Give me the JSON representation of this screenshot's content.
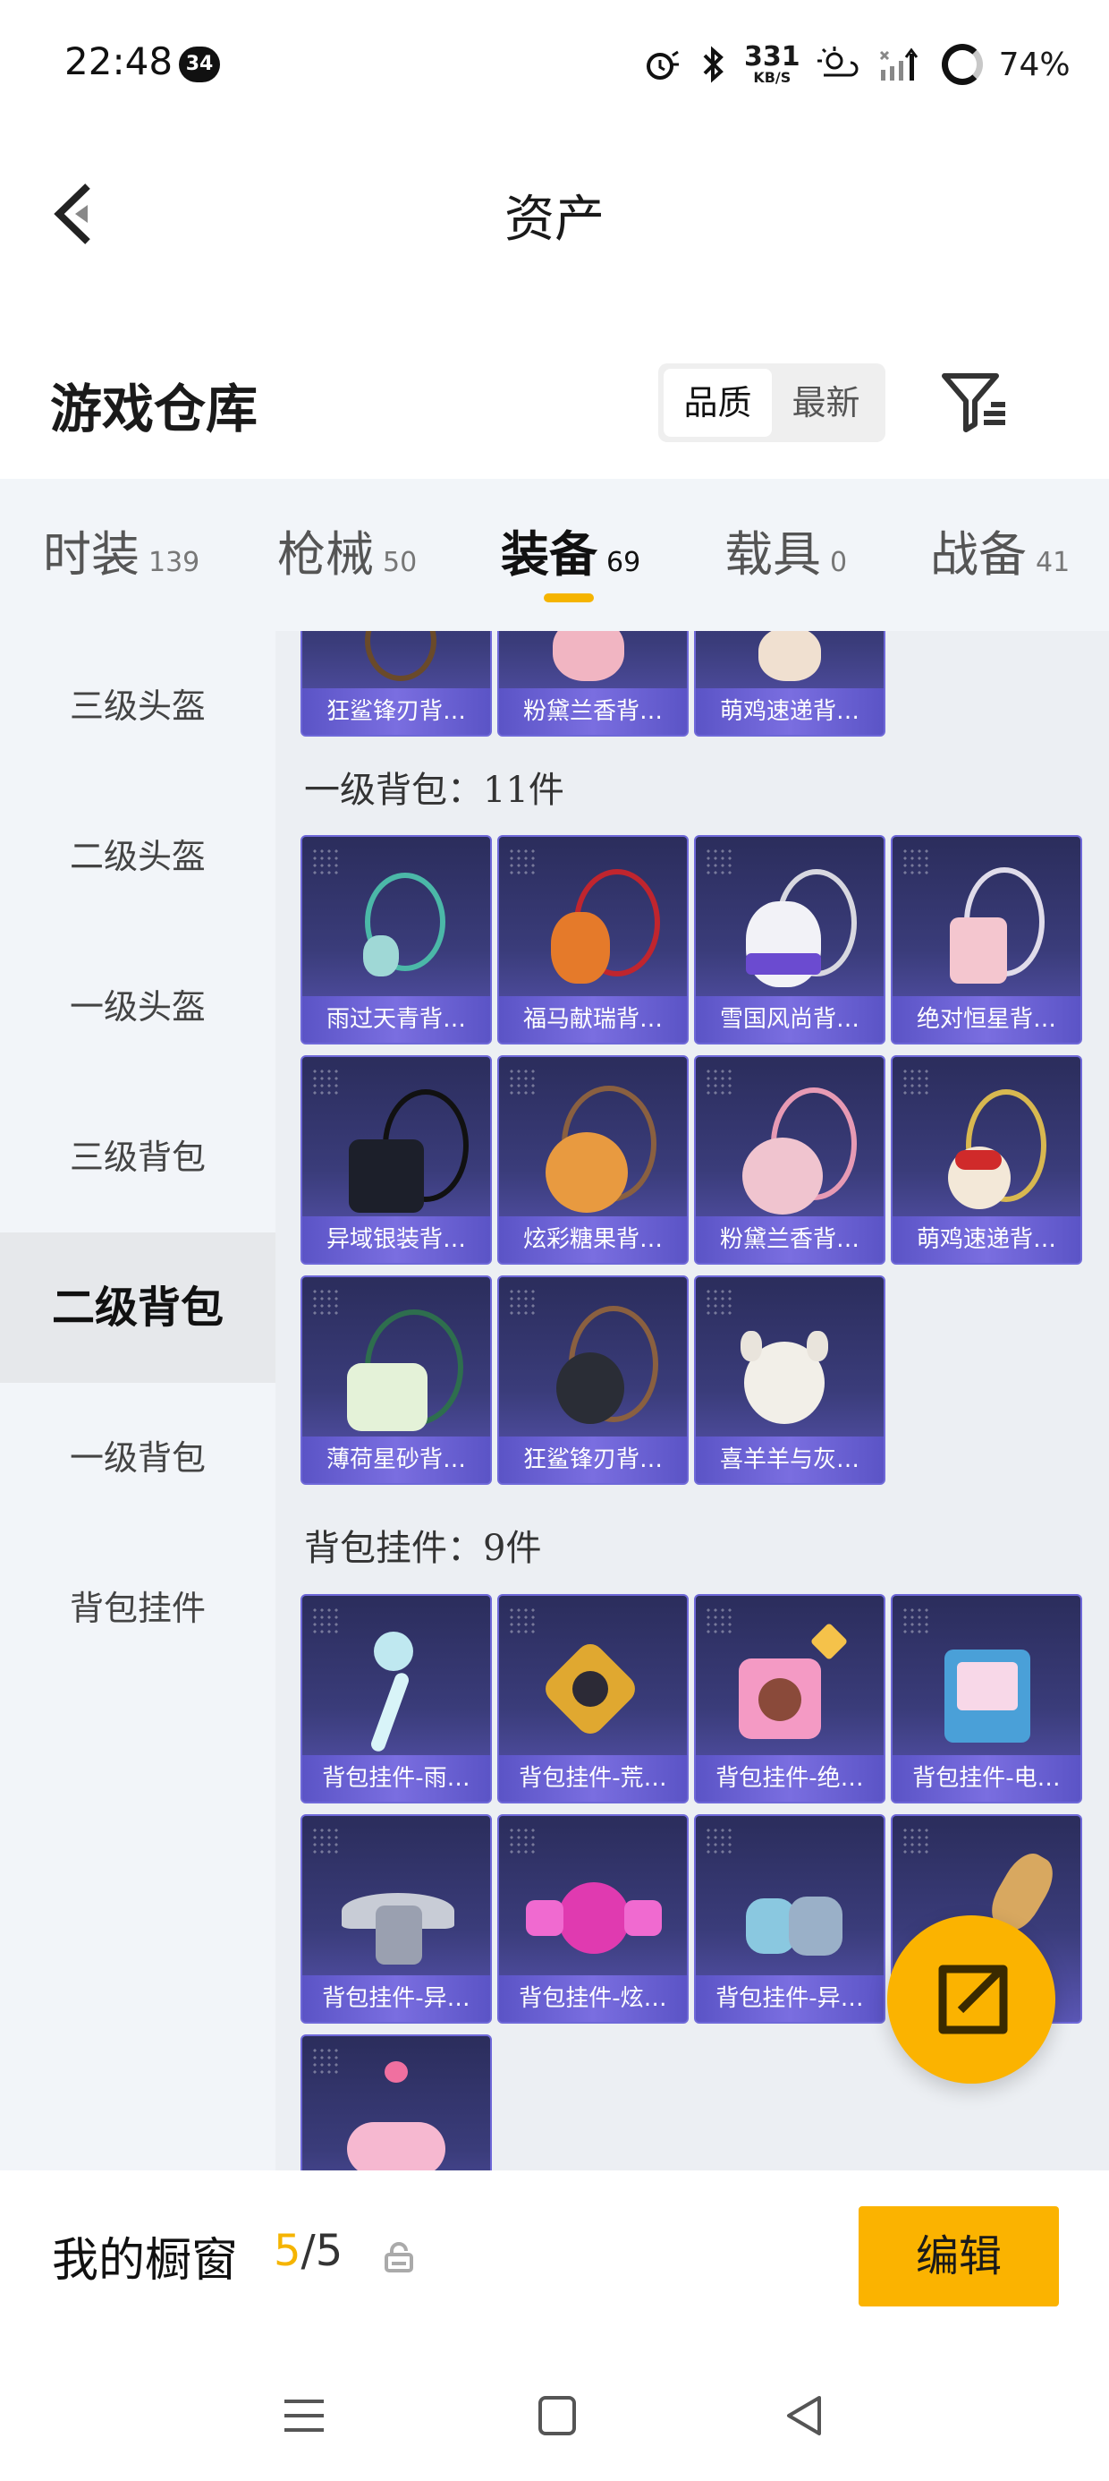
{
  "status": {
    "time": "22:48",
    "badge": "34",
    "speed_value": "331",
    "speed_unit": "KB/S",
    "battery": "74%",
    "icons": [
      "alarm-icon",
      "bluetooth-icon",
      "network-speed",
      "weather-icon",
      "signal-icon",
      "battery-icon"
    ]
  },
  "nav": {
    "title": "资产",
    "back_icon": "chevron-left-icon"
  },
  "warehouse": {
    "title": "游戏仓库",
    "sort_options": [
      "品质",
      "最新"
    ],
    "active_sort": "品质",
    "filter_icon": "filter-icon"
  },
  "tabs": [
    {
      "label": "时装",
      "count": "139"
    },
    {
      "label": "枪械",
      "count": "50"
    },
    {
      "label": "装备",
      "count": "69"
    },
    {
      "label": "载具",
      "count": "0"
    },
    {
      "label": "战备",
      "count": "41"
    }
  ],
  "active_tab": "装备",
  "accent_color": "#f5b400",
  "sidebar": {
    "items": [
      {
        "label": "三级头盔"
      },
      {
        "label": "二级头盔"
      },
      {
        "label": "一级头盔"
      },
      {
        "label": "三级背包"
      },
      {
        "label": "二级背包"
      },
      {
        "label": "一级背包"
      },
      {
        "label": "背包挂件"
      }
    ],
    "active": "二级背包"
  },
  "sections": {
    "top_partial": {
      "items": [
        "狂鲨锋刃背…",
        "粉黛兰香背…",
        "萌鸡速递背…"
      ]
    },
    "level1_backpacks": {
      "title": "一级背包：11件",
      "items": [
        "雨过天青背…",
        "福马献瑞背…",
        "雪国风尚背…",
        "绝对恒星背…",
        "异域银装背…",
        "炫彩糖果背…",
        "粉黛兰香背…",
        "萌鸡速递背…",
        "薄荷星砂背…",
        "狂鲨锋刃背…",
        "喜羊羊与灰…"
      ]
    },
    "backpack_charms": {
      "title": "背包挂件：9件",
      "items": [
        "背包挂件-雨…",
        "背包挂件-荒…",
        "背包挂件-绝…",
        "背包挂件-电…",
        "背包挂件-异…",
        "背包挂件-炫…",
        "背包挂件-异…",
        "",
        ""
      ]
    }
  },
  "fab": {
    "icon": "share-external-icon"
  },
  "showcase": {
    "label": "我的橱窗",
    "count_current": "5",
    "count_sep": "/",
    "count_total": "5",
    "lock_icon": "lock-icon",
    "edit_label": "编辑"
  },
  "system_nav": [
    "menu-icon",
    "home-icon",
    "back-icon"
  ]
}
